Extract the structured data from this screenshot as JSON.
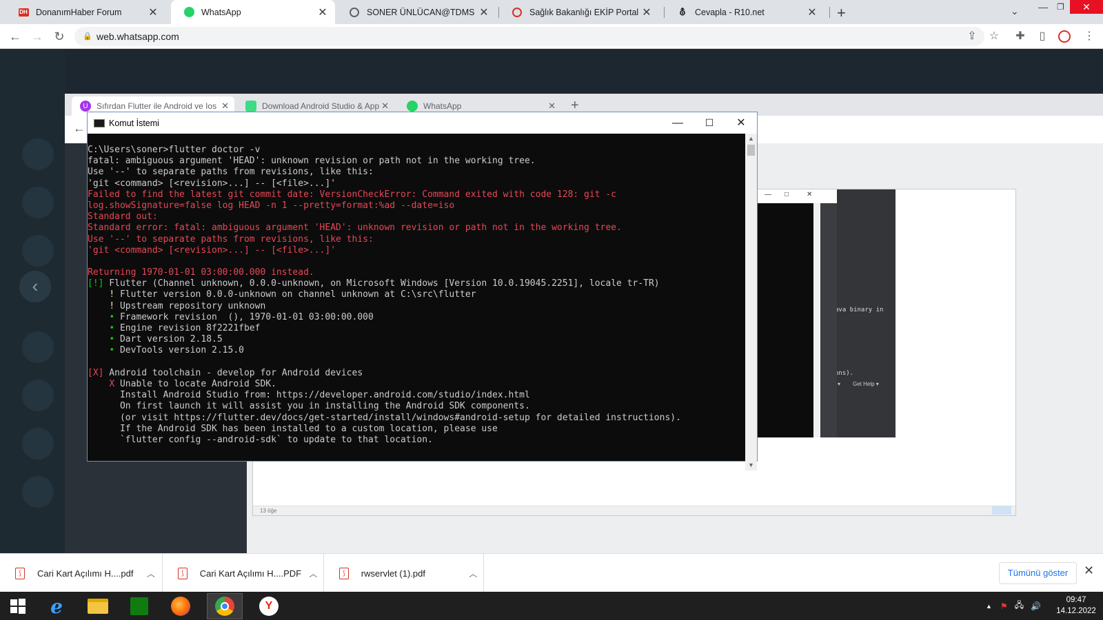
{
  "browser": {
    "tabs": [
      {
        "title": "DonanımHaber Forum",
        "icon": "dh-icon"
      },
      {
        "title": "WhatsApp",
        "icon": "whatsapp-icon",
        "active": true
      },
      {
        "title": "SONER ÜNLÜCAN@TDMS",
        "icon": "globe-icon"
      },
      {
        "title": "Sağlık Bakanlığı EKİP Portal",
        "icon": "ministry-icon"
      },
      {
        "title": "Cevapla - R10.net",
        "icon": "r10-icon"
      }
    ],
    "url": "web.whatsapp.com"
  },
  "inner_browser": {
    "tabs": [
      {
        "title": "Sıfırdan Flutter ile Android ve Ios"
      },
      {
        "title": "Download Android Studio & App"
      },
      {
        "title": "WhatsApp"
      }
    ]
  },
  "cmd": {
    "title": "Komut İstemi",
    "lines": [
      {
        "t": "C:\\Users\\soner>flutter doctor -v",
        "c": ""
      },
      {
        "t": "fatal: ambiguous argument 'HEAD': unknown revision or path not in the working tree.",
        "c": ""
      },
      {
        "t": "Use '--' to separate paths from revisions, like this:",
        "c": ""
      },
      {
        "t": "'git <command> [<revision>...] -- [<file>...]'",
        "c": ""
      },
      {
        "t": "Failed to find the latest git commit date: VersionCheckError: Command exited with code 128: git -c",
        "c": "red"
      },
      {
        "t": "log.showSignature=false log HEAD -n 1 --pretty=format:%ad --date=iso",
        "c": "red"
      },
      {
        "t": "Standard out:",
        "c": "red"
      },
      {
        "t": "Standard error: fatal: ambiguous argument 'HEAD': unknown revision or path not in the working tree.",
        "c": "red"
      },
      {
        "t": "Use '--' to separate paths from revisions, like this:",
        "c": "red"
      },
      {
        "t": "'git <command> [<revision>...] -- [<file>...]'",
        "c": "red"
      },
      {
        "t": "",
        "c": ""
      },
      {
        "t": "Returning 1970-01-01 03:00:00.000 instead.",
        "c": "red"
      },
      {
        "t": "[!] Flutter (Channel unknown, 0.0.0-unknown, on Microsoft Windows [Version 10.0.19045.2251], locale tr-TR)",
        "c": "yelmark"
      },
      {
        "t": "    ! Flutter version 0.0.0-unknown on channel unknown at C:\\src\\flutter",
        "c": "bang"
      },
      {
        "t": "    ! Upstream repository unknown",
        "c": "bang"
      },
      {
        "t": "    • Framework revision  (), 1970-01-01 03:00:00.000",
        "c": "dot"
      },
      {
        "t": "    • Engine revision 8f2221fbef",
        "c": "dot"
      },
      {
        "t": "    • Dart version 2.18.5",
        "c": "dot"
      },
      {
        "t": "    • DevTools version 2.15.0",
        "c": "dot"
      },
      {
        "t": "",
        "c": ""
      },
      {
        "t": "[X] Android toolchain - develop for Android devices",
        "c": "redmark"
      },
      {
        "t": "    X Unable to locate Android SDK.",
        "c": "xmark"
      },
      {
        "t": "      Install Android Studio from: https://developer.android.com/studio/index.html",
        "c": ""
      },
      {
        "t": "      On first launch it will assist you in installing the Android SDK components.",
        "c": ""
      },
      {
        "t": "      (or visit https://flutter.dev/docs/get-started/install/windows#android-setup for detailed instructions).",
        "c": ""
      },
      {
        "t": "      If the Android SDK has been installed to a custom location, please use",
        "c": ""
      },
      {
        "t": "      `flutter config --android-sdk` to update to that location.",
        "c": ""
      }
    ]
  },
  "bg_window": {
    "text1": "ava binary in",
    "text2": "ons).",
    "menu1": "Get Help ▾",
    "footer": "13 öğe"
  },
  "downloads": {
    "items": [
      {
        "name": "Cari Kart Açılımı H....pdf"
      },
      {
        "name": "Cari Kart Açılımı H....PDF"
      },
      {
        "name": "rwservlet (1).pdf"
      }
    ],
    "show_all": "Tümünü göster"
  },
  "taskbar": {
    "time": "09:47",
    "date": "14.12.2022"
  }
}
